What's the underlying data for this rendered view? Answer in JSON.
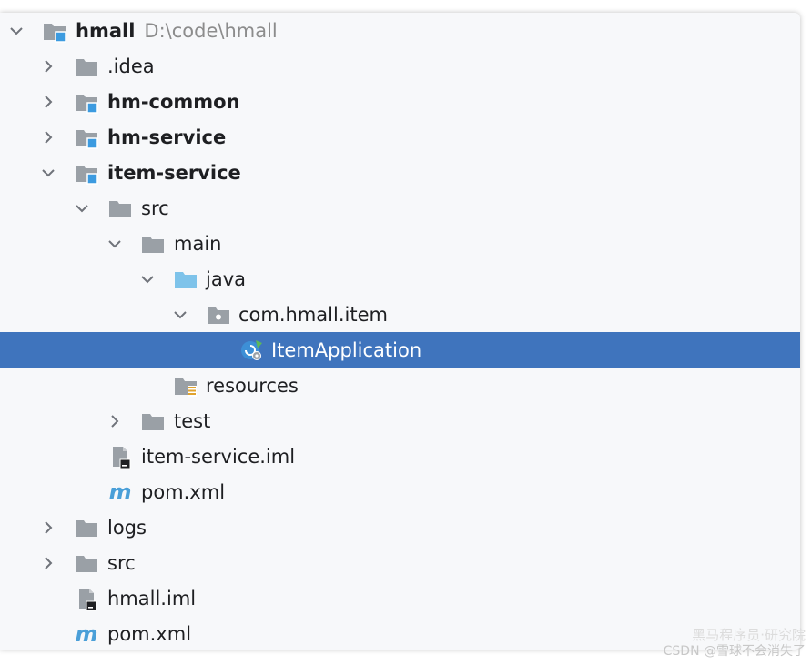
{
  "tree": {
    "root": {
      "name": "hmall",
      "path": "D:\\code\\hmall"
    },
    "items": [
      {
        "label": ".idea"
      },
      {
        "label": "hm-common"
      },
      {
        "label": "hm-service"
      },
      {
        "label": "item-service"
      },
      {
        "label": "src"
      },
      {
        "label": "main"
      },
      {
        "label": "java"
      },
      {
        "label": "com.hmall.item"
      },
      {
        "label": "ItemApplication"
      },
      {
        "label": "resources"
      },
      {
        "label": "test"
      },
      {
        "label": "item-service.iml"
      },
      {
        "label": "pom.xml"
      },
      {
        "label": "logs"
      },
      {
        "label": "src"
      },
      {
        "label": "hmall.iml"
      },
      {
        "label": "pom.xml"
      }
    ]
  },
  "watermark": {
    "line1": "黑马程序员·研究院",
    "line2": "CSDN @雪球不会消失了"
  },
  "colors": {
    "selection": "#3f74bd",
    "folder": "#9aa0a6",
    "source_folder": "#7ec3ea",
    "module_badge": "#3c9be0"
  }
}
